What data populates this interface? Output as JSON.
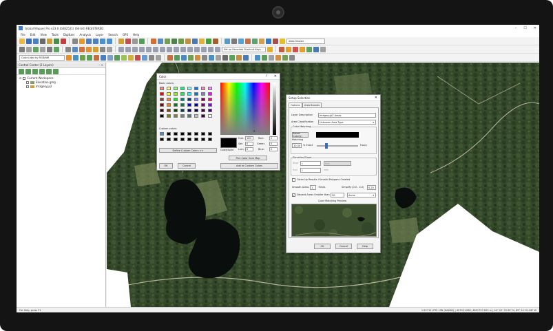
{
  "window": {
    "title": "Global Mapper Pro v23.0 (b082521) (64-bit) REGISTERED",
    "controls": [
      "–",
      "☐",
      "✕"
    ]
  },
  "menu": [
    "File",
    "Edit",
    "View",
    "Tools",
    "Digitizer",
    "Analysis",
    "Layer",
    "Search",
    "GPS",
    "Help"
  ],
  "toolbar": {
    "basemap_combo": "Atlas Shader",
    "shortcut_combo": "Set up Favorites Shortcut Keys...",
    "color_combo": "Color Lidar by RGB/NIR"
  },
  "control_center": {
    "title": "Control Center (2 Layers)",
    "buttons": [
      "–",
      "✕"
    ],
    "workspace": "Current Workspace",
    "layers": [
      "Elevation.gmg",
      "Imagery.jp2"
    ]
  },
  "color_dialog": {
    "title": "Color",
    "help": "?",
    "close": "✕",
    "basic_colors_label": "Basic colors:",
    "custom_colors_label": "Custom colors:",
    "basic_colors": [
      "#ff8080",
      "#ffff80",
      "#80ff80",
      "#00ff80",
      "#80ffff",
      "#0080ff",
      "#ff80c0",
      "#ff80ff",
      "#ff0000",
      "#ffff00",
      "#80ff00",
      "#00ff40",
      "#00ffff",
      "#0080c0",
      "#8080c0",
      "#ff00ff",
      "#804040",
      "#ff8040",
      "#00ff00",
      "#008080",
      "#004080",
      "#8080ff",
      "#800040",
      "#ff0080",
      "#800000",
      "#ff8000",
      "#008000",
      "#008040",
      "#0000ff",
      "#0000a0",
      "#800080",
      "#8000ff",
      "#400000",
      "#804000",
      "#004000",
      "#004040",
      "#000080",
      "#000040",
      "#400040",
      "#400080",
      "#000000",
      "#808000",
      "#808040",
      "#808080",
      "#408080",
      "#c0c0c0",
      "#400040",
      "#ffffff"
    ],
    "custom_colors": [
      "#4a90c8",
      "#000000",
      "#000000",
      "#000000",
      "#000000",
      "#000000",
      "#000000",
      "#000000",
      "#000000",
      "#000000",
      "#000000",
      "#000000",
      "#000000",
      "#000000",
      "#000000",
      "#000000"
    ],
    "color_solid_label": "Color|Solid",
    "hue_label": "Hue:",
    "hue": "160",
    "sat_label": "Sat:",
    "sat": "0",
    "lum_label": "Lum:",
    "lum": "0",
    "red_label": "Red:",
    "red": "0",
    "green_label": "Green:",
    "green": "0",
    "blue_label": "Blue:",
    "blue": "0",
    "pick_button": "Pick Color from Map",
    "define_button": "Define Custom Colors >>",
    "add_button": "Add to Custom Colors",
    "ok": "OK",
    "cancel": "Cancel"
  },
  "setup_dialog": {
    "title": "Setup Selection",
    "close": "✕",
    "tabs": [
      "Options",
      "Area Bounds"
    ],
    "layer_desc_label": "Layer Description",
    "layer_desc": "Imagery.jp2 Areas",
    "area_class_label": "Area Classification",
    "area_class": "Unknown Area Type",
    "color_matching_group": "Color Matching",
    "select_color_label": "Select Color(s)",
    "matching_label": "Matching",
    "matching_value": "10.00",
    "exact_label": "% Exact",
    "fuzzy_label": "Fuzzy",
    "elev_group": "Elevation/Slope",
    "start_label": "Start",
    "start_value": "0",
    "end_label": "End",
    "end_value": "0",
    "unit_label": "feet",
    "cleanup_label": "Clean Up Results if Invalid Polygons Created",
    "smooth_label": "Smooth Areas",
    "smooth_value": "1",
    "times_label": "Times",
    "simplify_label": "Simplify (0.0 - 4.0)",
    "simplify_value": "0.25",
    "discard_label": "Discard Areas Smaller than",
    "discard_value": "50",
    "discard_unit": "Acres",
    "preview_label": "Color Matching Preview",
    "ok": "OK",
    "cancel": "Cancel",
    "help": "Help"
  },
  "status": {
    "left": "For Help, press F1",
    "right": "1:52712 UTM 19N (NAD83) | 457021.882, 4851757.629 m | 44° 22' 33.90\" N, 69° 24' 01.86\" W"
  }
}
